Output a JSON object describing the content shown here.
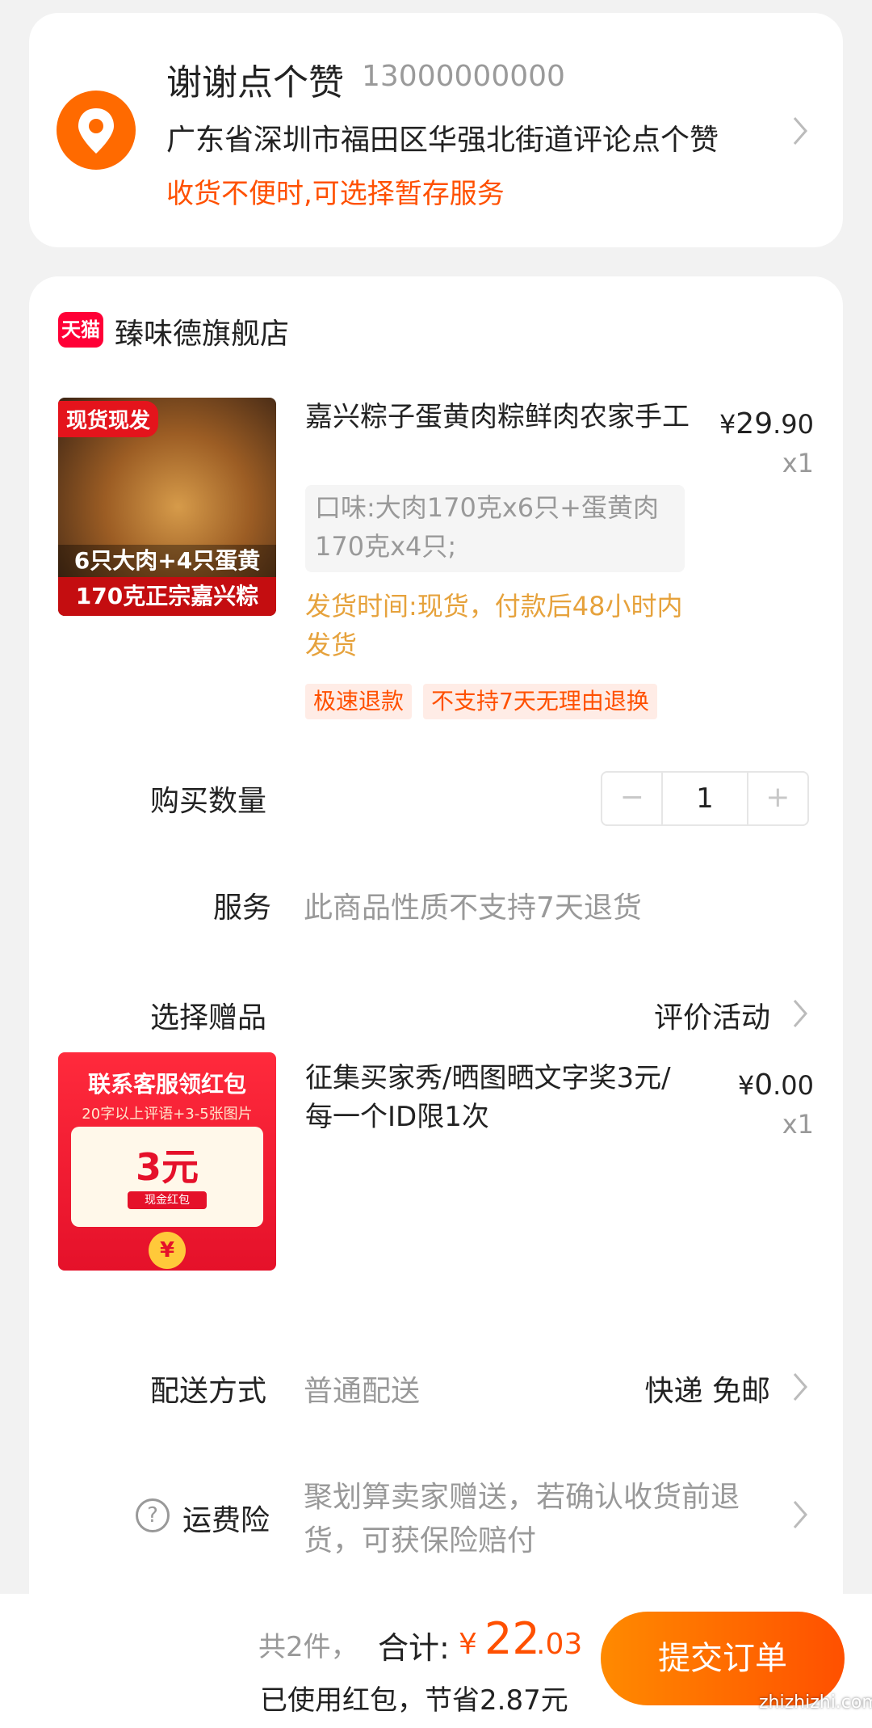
{
  "address": {
    "name": "谢谢点个赞",
    "phone": "13000000000",
    "detail": "广东省深圳市福田区华强北街道评论点个赞",
    "note": "收货不便时,可选择暂存服务"
  },
  "shop": {
    "badge": "天猫",
    "name": "臻味德旗舰店"
  },
  "product": {
    "image_tag": "现货现发",
    "image_band1": "6只大肉+4只蛋黄",
    "image_band2": "170克正宗嘉兴粽",
    "title": "嘉兴粽子蛋黄肉粽鲜肉农家手工",
    "price_symbol": "¥",
    "price_int": "29",
    "price_dec": ".90",
    "quantity": "x1",
    "sku": "口味:大肉170克x6只+蛋黄肉170克x4只;",
    "ship_time": "发货时间:现货，付款后48小时内发货",
    "tags": [
      "极速退款",
      "不支持7天无理由退换"
    ]
  },
  "purchase_qty": {
    "label": "购买数量",
    "minus": "−",
    "value": "1",
    "plus": "+"
  },
  "service": {
    "label": "服务",
    "value": "此商品性质不支持7天退货"
  },
  "gift_select": {
    "label": "选择赠品",
    "value": "评价活动"
  },
  "gift_item": {
    "image_title": "联系客服领红包",
    "image_sub": "20字以上评语+3-5张图片",
    "image_amount": "3元",
    "image_cash": "现金红包",
    "image_coin": "¥",
    "title": "征集买家秀/晒图晒文字奖3元/每一个ID限1次",
    "price_symbol": "¥",
    "price_int": "0",
    "price_dec": ".00",
    "quantity": "x1"
  },
  "delivery": {
    "label": "配送方式",
    "value": "普通配送",
    "method": "快递 免邮"
  },
  "insurance": {
    "icon": "?",
    "label": "运费险",
    "value": "聚划算卖家赠送，若确认收货前退货，可获保险赔付"
  },
  "bottom": {
    "count": "共2件，",
    "total_label": "合计:",
    "yen": "¥",
    "total_int": "22",
    "total_dec": ".03",
    "saved": "已使用红包，节省2.87元",
    "submit": "提交订单",
    "watermark": "zhizhizhi.com"
  }
}
